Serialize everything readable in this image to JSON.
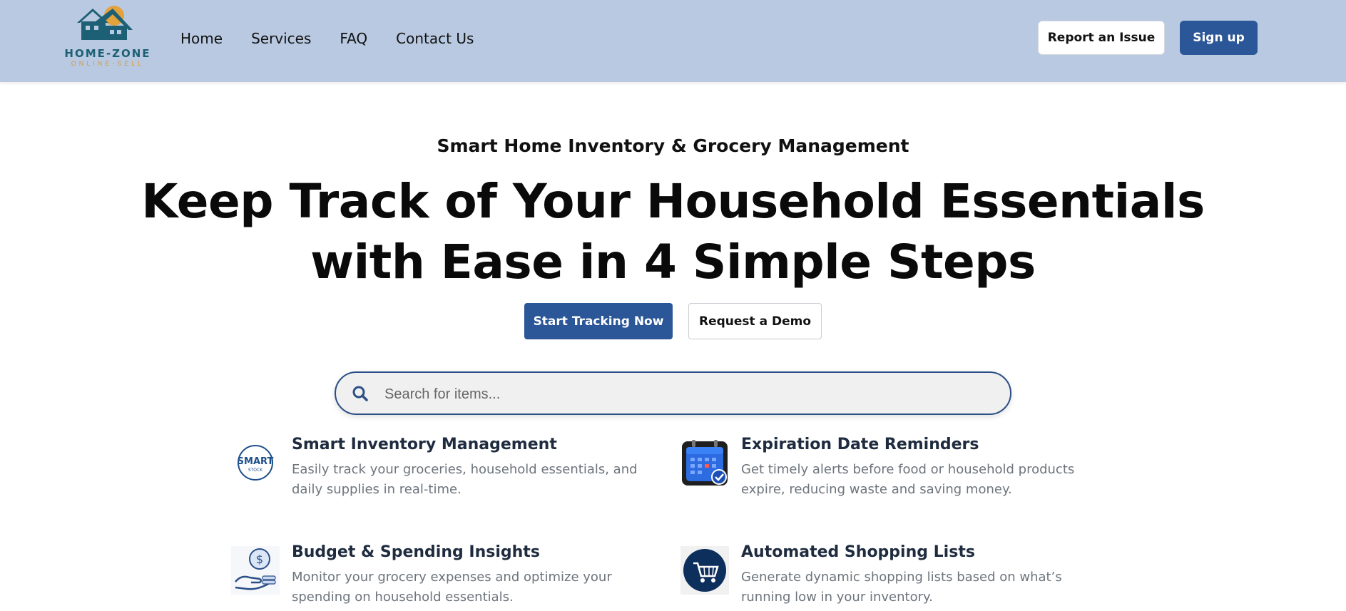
{
  "brand": {
    "name": "HOME-ZONE",
    "tagline": "ONLINE-SELL",
    "primary_color": "#2b5697",
    "nav_bg": "#b8c9e1"
  },
  "nav": {
    "links": [
      "Home",
      "Services",
      "FAQ",
      "Contact Us"
    ]
  },
  "header_actions": {
    "report_label": "Report an Issue",
    "signup_label": "Sign up"
  },
  "hero": {
    "subtitle": "Smart Home Inventory & Grocery Management",
    "headline_line1": "Keep Track of Your Household Essentials",
    "headline_line2": "with Ease in 4 Simple Steps",
    "primary_cta": "Start Tracking Now",
    "secondary_cta": "Request a Demo"
  },
  "search": {
    "placeholder": "Search for items..."
  },
  "features": [
    {
      "title": "Smart Inventory Management",
      "description": "Easily track your groceries, household essentials, and daily supplies in real-time.",
      "icon": "smart-stock-icon",
      "icon_text_top": "SMART",
      "icon_text_bottom": "STOCK"
    },
    {
      "title": "Expiration Date Reminders",
      "description": "Get timely alerts before food or household products expire, reducing waste and saving money.",
      "icon": "calendar-icon"
    },
    {
      "title": "Budget & Spending Insights",
      "description": "Monitor your grocery expenses and optimize your spending on household essentials.",
      "icon": "money-hand-icon"
    },
    {
      "title": "Automated Shopping Lists",
      "description": "Generate dynamic shopping lists based on what’s running low in your inventory.",
      "icon": "shopping-cart-icon"
    }
  ]
}
